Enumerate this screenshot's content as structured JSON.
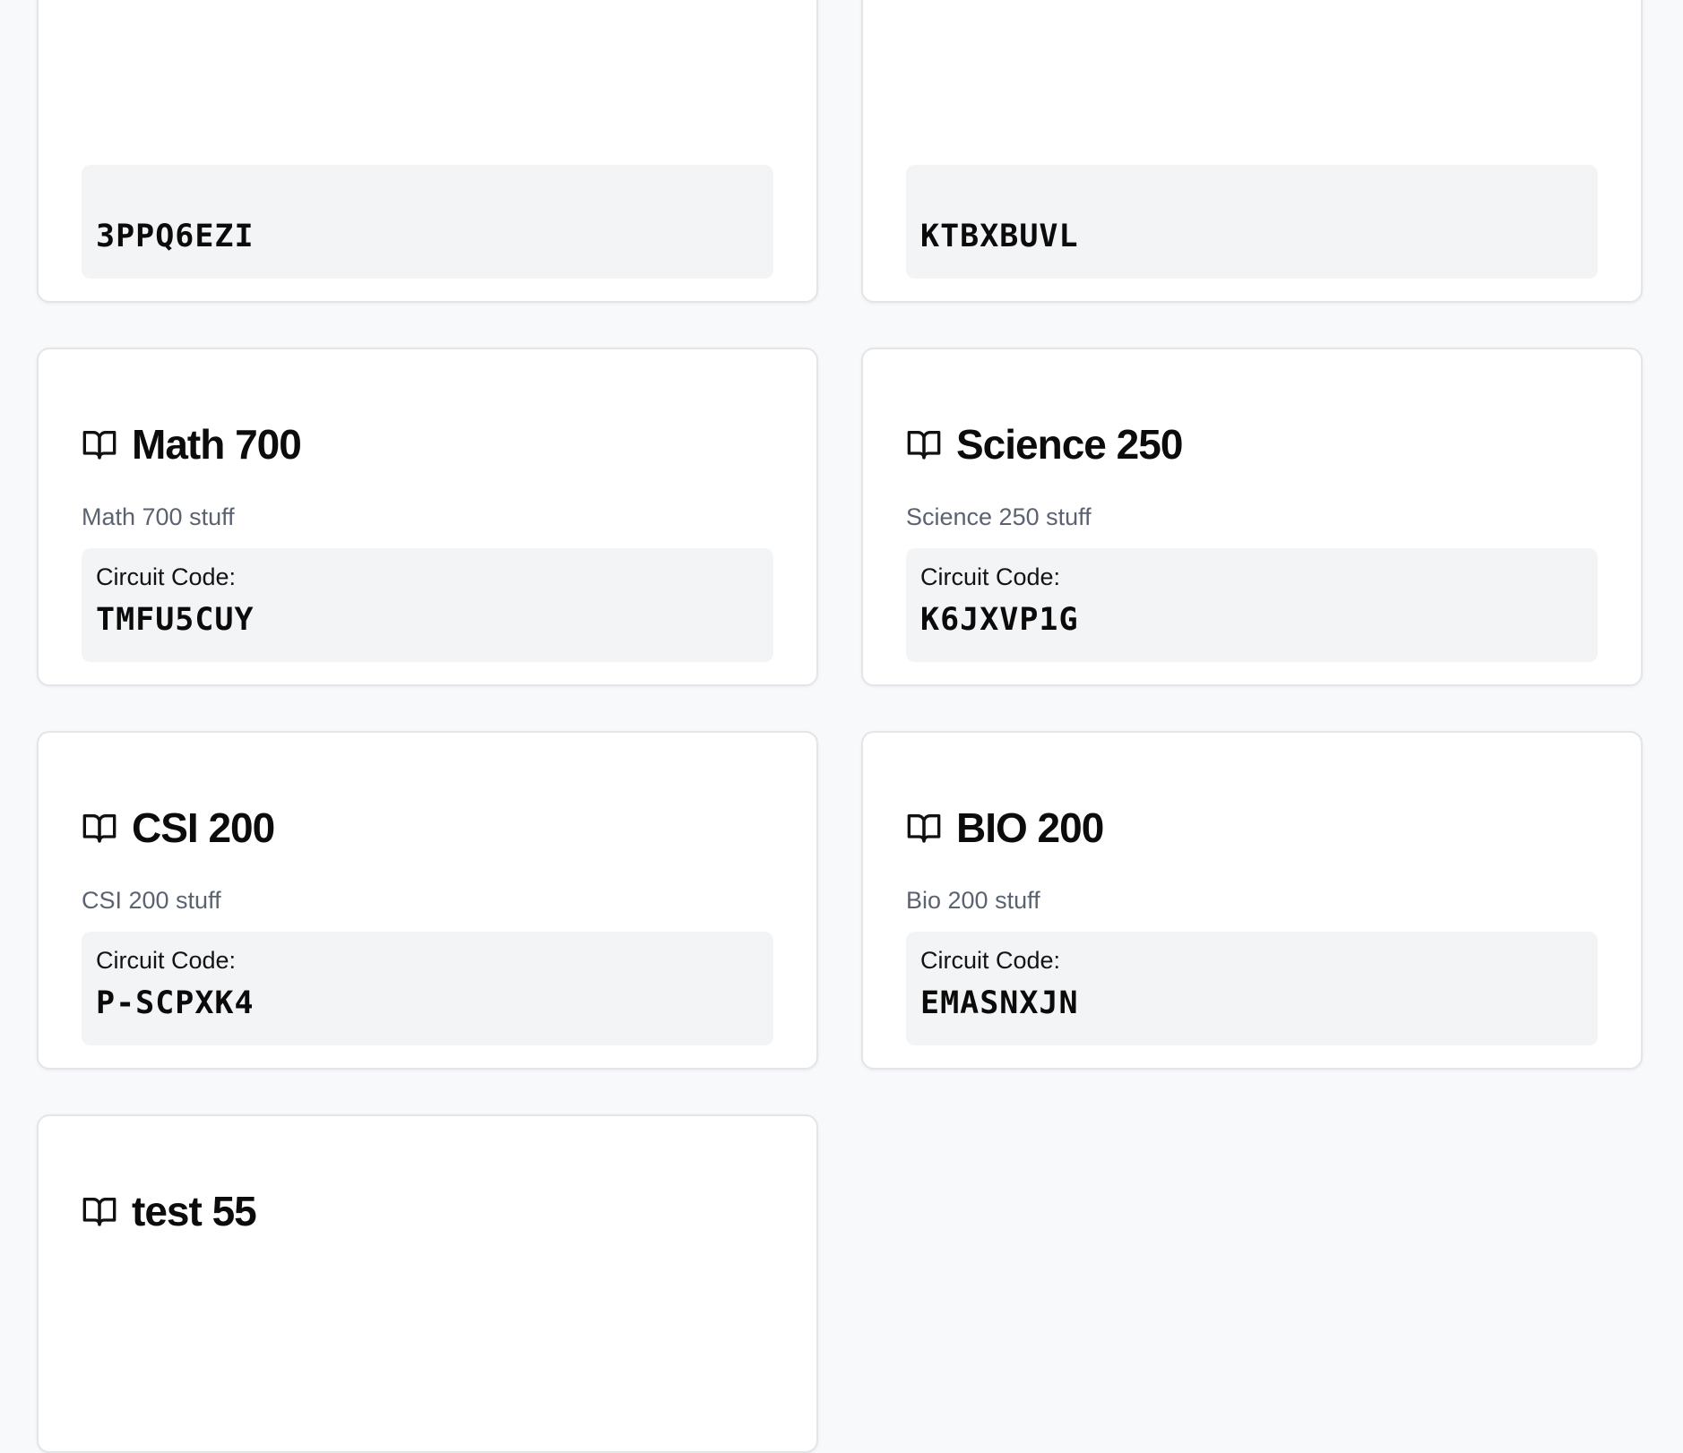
{
  "icon": "open-book-icon",
  "colors": {
    "background": "#f8f9fb",
    "card": "#ffffff",
    "card_border": "#e3e5e9",
    "code_box": "#f3f4f6",
    "description": "#5b6270"
  },
  "courses": [
    {
      "title": "",
      "description": "",
      "code_label": "",
      "code": "3PPQ6EZI"
    },
    {
      "title": "",
      "description": "",
      "code_label": "",
      "code": "KTBXBUVL"
    },
    {
      "title": "Math 700",
      "description": "Math 700 stuff",
      "code_label": "Circuit Code:",
      "code": "TMFU5CUY"
    },
    {
      "title": "Science 250",
      "description": "Science 250 stuff",
      "code_label": "Circuit Code:",
      "code": "K6JXVP1G"
    },
    {
      "title": "CSI 200",
      "description": "CSI 200 stuff",
      "code_label": "Circuit Code:",
      "code": "P-SCPXK4"
    },
    {
      "title": "BIO 200",
      "description": "Bio 200 stuff",
      "code_label": "Circuit Code:",
      "code": "EMASNXJN"
    },
    {
      "title": "test 55",
      "description": "",
      "code_label": "",
      "code": ""
    }
  ]
}
